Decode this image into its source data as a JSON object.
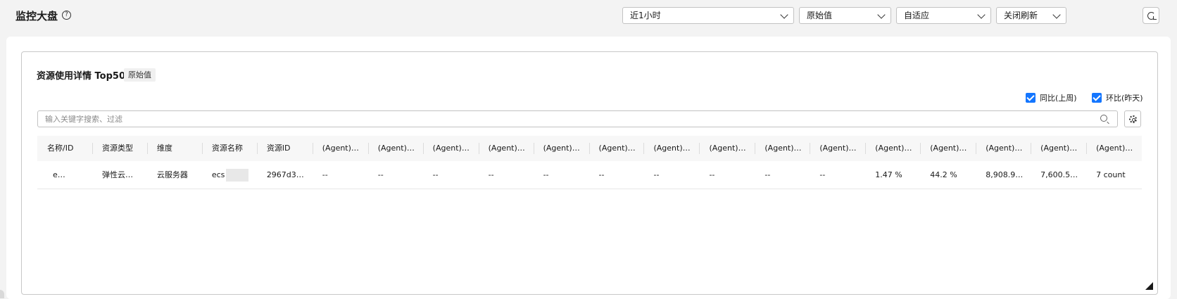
{
  "header": {
    "title": "监控大盘",
    "help_glyph": "?",
    "time_range": "近1小时",
    "value_mode": "原始值",
    "layout_mode": "自适应",
    "refresh_mode": "关闭刷新"
  },
  "card": {
    "title": "资源使用详情 Top50",
    "tag": "原始值",
    "compare_week_label": "同比(上周)",
    "compare_day_label": "环比(昨天)",
    "search_placeholder": "输入关键字搜索、过滤"
  },
  "table": {
    "columns": [
      "名称/ID",
      "资源类型",
      "维度",
      "资源名称",
      "资源ID",
      "(Agent)…",
      "(Agent)…",
      "(Agent)…",
      "(Agent)…",
      "(Agent)…",
      "(Agent)…",
      "(Agent)…",
      "(Agent)…",
      "(Agent)…",
      "(Agent)…",
      "(Agent)…",
      "(Agent)…",
      "(Agent)…",
      "(Agent)…",
      "(Agent)…"
    ],
    "rows": [
      [
        "e…",
        "弹性云…",
        "云服务器",
        "ecs",
        "2967d3…",
        "--",
        "--",
        "--",
        "--",
        "--",
        "--",
        "--",
        "--",
        "--",
        "--",
        "1.47 %",
        "44.2 %",
        "8,908.9…",
        "7,600.5…",
        "7 count"
      ]
    ]
  },
  "colors": {
    "accent": "#1476ff",
    "page_bg": "#f3f3f3",
    "header_row_bg": "#f7f7f7"
  },
  "icons": {
    "help": "question-circle-icon",
    "chevron": "chevron-down-icon",
    "refresh": "refresh-icon",
    "search": "search-icon",
    "settings": "gear-icon",
    "resize": "resize-corner-icon"
  }
}
